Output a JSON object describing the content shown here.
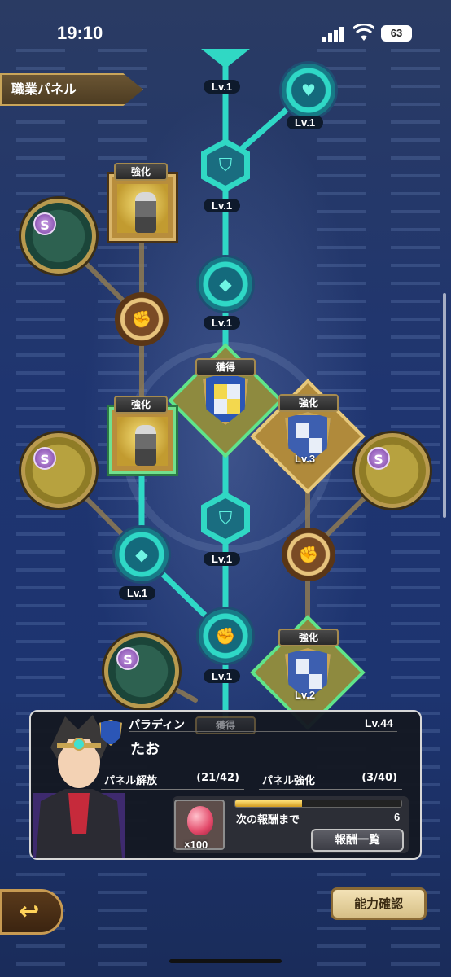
{
  "status_bar": {
    "time": "19:10",
    "battery": "63"
  },
  "title": "職業パネル",
  "nodes": {
    "lv1_a": "Lv.1",
    "lv1_b": "Lv.1",
    "lv1_c": "Lv.1",
    "lv1_d": "Lv.1",
    "lv1_e": "Lv.1",
    "lv1_f": "Lv.1",
    "lv1_g": "Lv.1",
    "lv3": "Lv.3",
    "lv2": "Lv.2",
    "s_badge": "S",
    "enhance": "強化",
    "acquired": "獲得",
    "acquired_bottom": "獲得"
  },
  "character": {
    "job": "パラディン",
    "level": "Lv.44",
    "name": "たお",
    "panel_unlock_label": "パネル解放",
    "panel_unlock_value": "(21/42)",
    "panel_enhance_label": "パネル強化",
    "panel_enhance_value": "(3/40)"
  },
  "reward": {
    "item_count": "×100",
    "next_label": "次の報酬まで",
    "next_count": "6",
    "progress": 0.4,
    "list_button": "報酬一覧"
  },
  "buttons": {
    "ability": "能力確認"
  },
  "colors": {
    "teal": "#30d8c4",
    "gold": "#c9a552",
    "background": "#1d3470"
  }
}
